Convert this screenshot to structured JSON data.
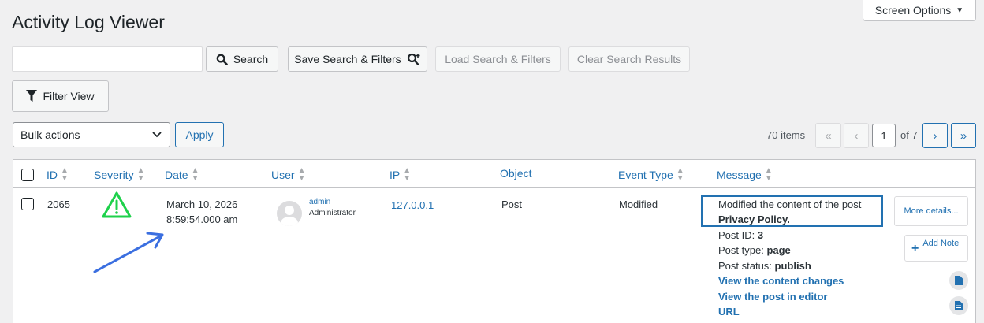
{
  "page": {
    "title": "Activity Log Viewer",
    "screen_options_label": "Screen Options"
  },
  "search": {
    "value": "",
    "search_label": "Search",
    "save_label": "Save Search & Filters",
    "load_label": "Load Search & Filters",
    "clear_label": "Clear Search Results",
    "filter_label": "Filter View"
  },
  "bulk": {
    "selected": "Bulk actions",
    "apply_label": "Apply"
  },
  "pagination": {
    "items_label": "70 items",
    "first": "«",
    "prev": "‹",
    "current_page": "1",
    "of_label": "of 7",
    "next": "›",
    "last": "»"
  },
  "columns": [
    "ID",
    "Severity",
    "Date",
    "User",
    "IP",
    "Object",
    "Event Type",
    "Message"
  ],
  "row": {
    "id": "2065",
    "date_line1": "March 10, 2026",
    "date_line2": "8:59:54.000 am",
    "user_name": "admin",
    "user_role": "Administrator",
    "ip": "127.0.0.1",
    "object": "Post",
    "event_type": "Modified",
    "message": {
      "line1": "Modified the content of the post",
      "line2": "Privacy Policy.",
      "post_id_label": "Post ID:",
      "post_id": "3",
      "post_type_label": "Post type:",
      "post_type": "page",
      "post_status_label": "Post status:",
      "post_status": "publish",
      "link_changes": "View the content changes",
      "link_editor": "View the post in editor",
      "link_url": "URL"
    },
    "more_details": "More details...",
    "add_note": "Add Note"
  },
  "colors": {
    "link": "#2271b1",
    "severity_warning": "#1ed14b",
    "annotation_arrow": "#3b6fe0"
  }
}
